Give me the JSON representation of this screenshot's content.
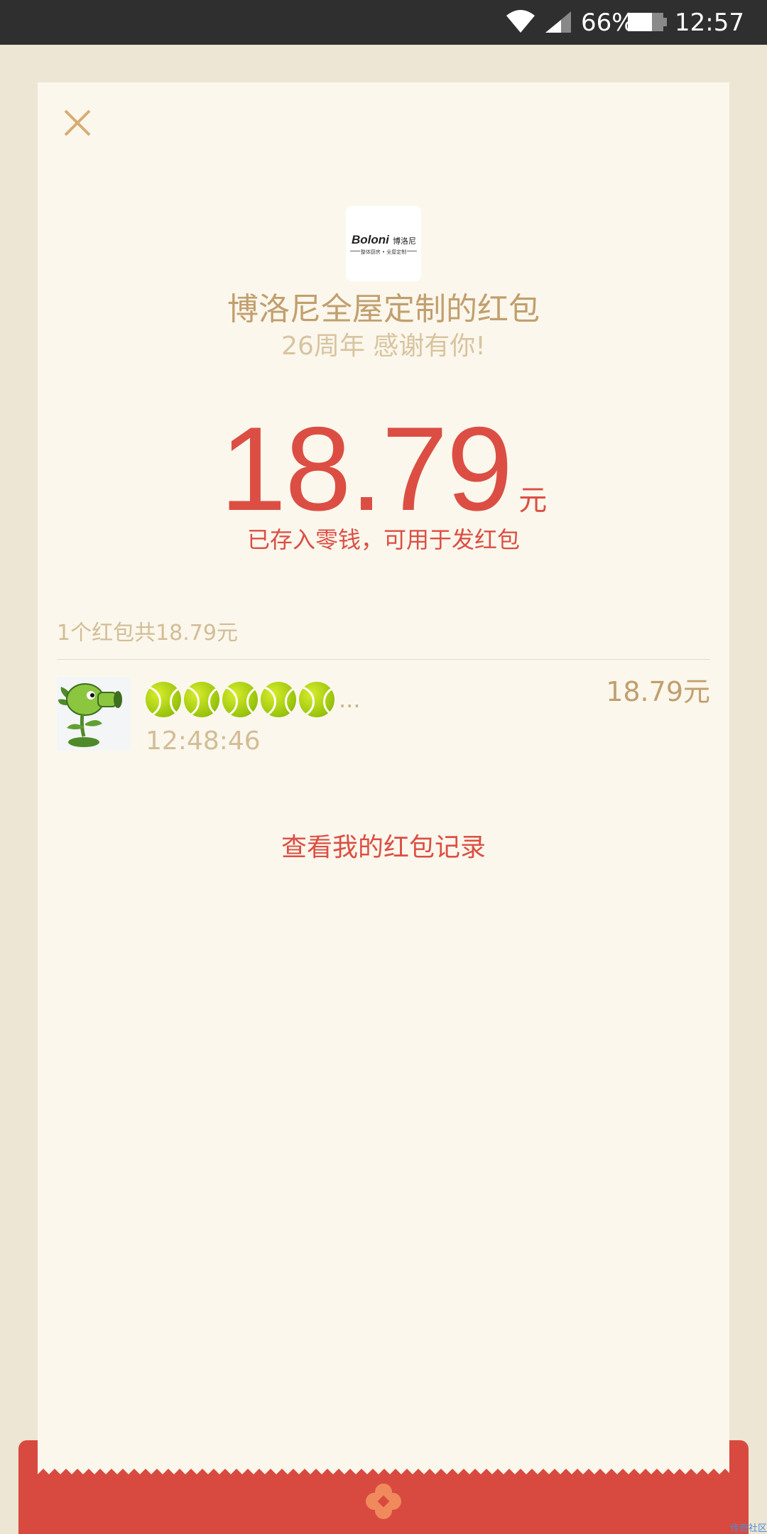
{
  "status_bar": {
    "battery": "66%",
    "time": "12:57"
  },
  "header": {
    "logo_text": "Boloni",
    "logo_cn": "博洛尼",
    "logo_sub": "整体厨房 • 全屋定制",
    "sender_name": "博洛尼全屋定制的红包",
    "greeting": "26周年 感谢有你!"
  },
  "amount": {
    "value": "18.79",
    "unit": "元",
    "note": "已存入零钱，可用于发红包"
  },
  "summary": "1个红包共18.79元",
  "records": [
    {
      "name_ellipsis": "...",
      "time": "12:48:46",
      "amount": "18.79元"
    }
  ],
  "record_link": "查看我的红包记录",
  "watermark": "传奇社区",
  "colors": {
    "accent_red": "#dc4e43",
    "gold": "#c19f6e",
    "card_bg": "#fbf7ec"
  }
}
